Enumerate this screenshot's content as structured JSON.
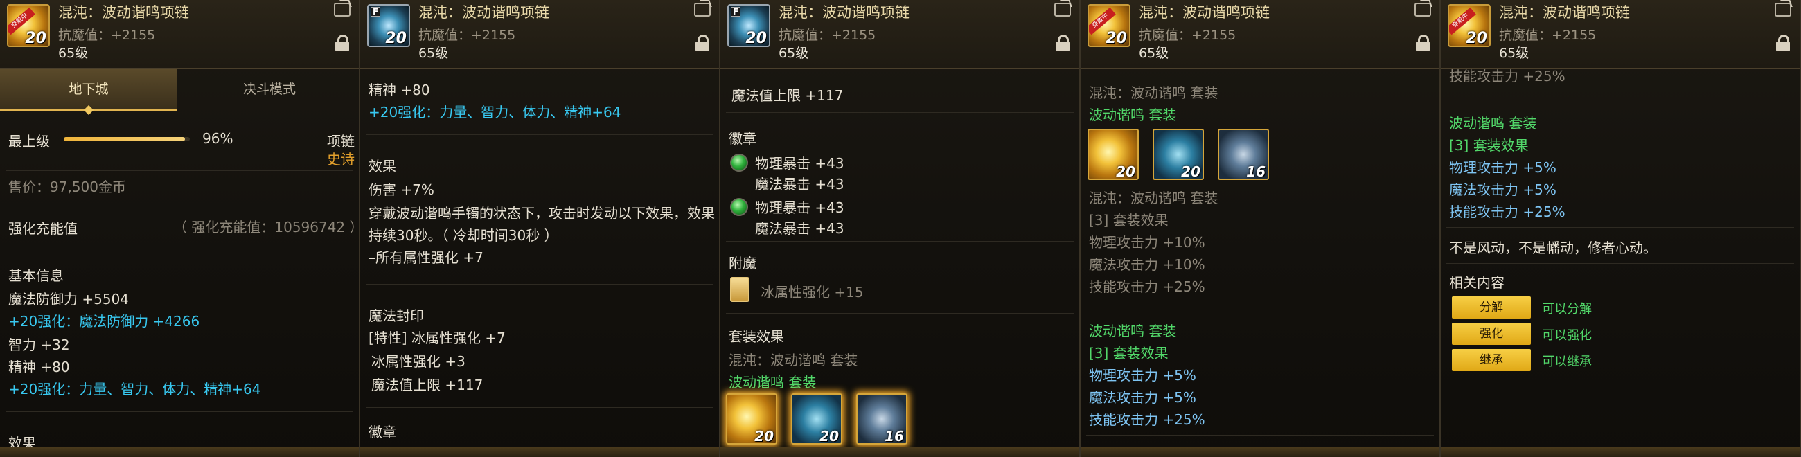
{
  "item": {
    "name": "混沌：波动谐鸣项链",
    "resist": "抗魔值：+2155",
    "level": "65级",
    "ribbon": "穿戴中",
    "icon_level": "20"
  },
  "panels": [
    {
      "tabs": {
        "dungeon": "地下城",
        "duel": "决斗模式"
      },
      "grade": {
        "label": "最上级",
        "percent_text": "96%",
        "percent_value": 0.96,
        "type": "项链",
        "rarity": "史诗"
      },
      "price": "售价：97,500金币",
      "refine": {
        "label": "强化充能值",
        "value": "（ 强化充能值：10596742 ）"
      },
      "basic": {
        "header": "基本信息",
        "magic_def": "魔法防御力 +5504",
        "enh_magic_def": "+20强化：魔法防御力 +4266",
        "int": "智力 +32",
        "spirit": "精神 +80",
        "enh_stats": "+20强化：力量、智力、体力、精神+64"
      },
      "cut_text": "效果"
    },
    {
      "spirit": "精神 +80",
      "enh_stats": "+20强化：力量、智力、体力、精神+64",
      "effect": {
        "header": "效果",
        "line1": "伤害 +7%",
        "line2": "穿戴波动谐鸣手镯的状态下，攻击时发动以下效果，效果",
        "line3": "持续30秒。（ 冷却时间30秒 ）",
        "line4": "–所有属性强化 +7"
      },
      "seal": {
        "header": "魔法封印",
        "trait": "[特性] 冰属性强化 +7",
        "ice": "冰属性强化 +3",
        "mp": "魔法值上限 +117"
      },
      "emblem_header": "徽章"
    },
    {
      "mp": "魔法值上限 +117",
      "emblem": {
        "header": "徽章",
        "g1_phys": "物理暴击 +43",
        "g1_mag": "魔法暴击 +43",
        "g2_phys": "物理暴击 +43",
        "g2_mag": "魔法暴击 +43"
      },
      "enchant": {
        "header": "附魔",
        "ice": "冰属性强化 +15"
      },
      "set": {
        "header": "套装效果",
        "chaos_line": "混沌：波动谐鸣 套装",
        "wave_line": "波动谐鸣 套装"
      },
      "slots": [
        "20",
        "20",
        "16"
      ]
    },
    {
      "chaos_line_top": "混沌：波动谐鸣 套装",
      "wave_line_top": "波动谐鸣 套装",
      "slots": [
        "20",
        "20",
        "16"
      ],
      "chaos_line": "混沌：波动谐鸣 套装",
      "set3": "[3] 套装效果",
      "phys10": "物理攻击力 +10%",
      "mag10": "魔法攻击力 +10%",
      "skill25": "技能攻击力 +25%",
      "wave_line": "波动谐鸣 套装",
      "set3b": "[3] 套装效果",
      "phys5": "物理攻击力 +5%",
      "mag5": "魔法攻击力 +5%",
      "skill25b": "技能攻击力 +25%"
    },
    {
      "cut_top": "技能攻击力 +25%",
      "wave_line": "波动谐鸣 套装",
      "set3": "[3] 套装效果",
      "phys5": "物理攻击力 +5%",
      "mag5": "魔法攻击力 +5%",
      "skill25": "技能攻击力 +25%",
      "flavor": "不是风动，不是幡动，修者心动。",
      "related": "相关内容",
      "buttons": [
        {
          "label": "分解",
          "desc": "可以分解"
        },
        {
          "label": "强化",
          "desc": "可以强化"
        },
        {
          "label": "继承",
          "desc": "可以继承"
        }
      ]
    }
  ],
  "colors": {
    "enhance": "#38c8f0",
    "set_green": "#52d86a",
    "stat_blue": "#7ec4f2",
    "accent_gold": "#e3a02c"
  },
  "icons": [
    "share-icon",
    "lock-icon",
    "gem-icon",
    "enchant-card-icon"
  ]
}
